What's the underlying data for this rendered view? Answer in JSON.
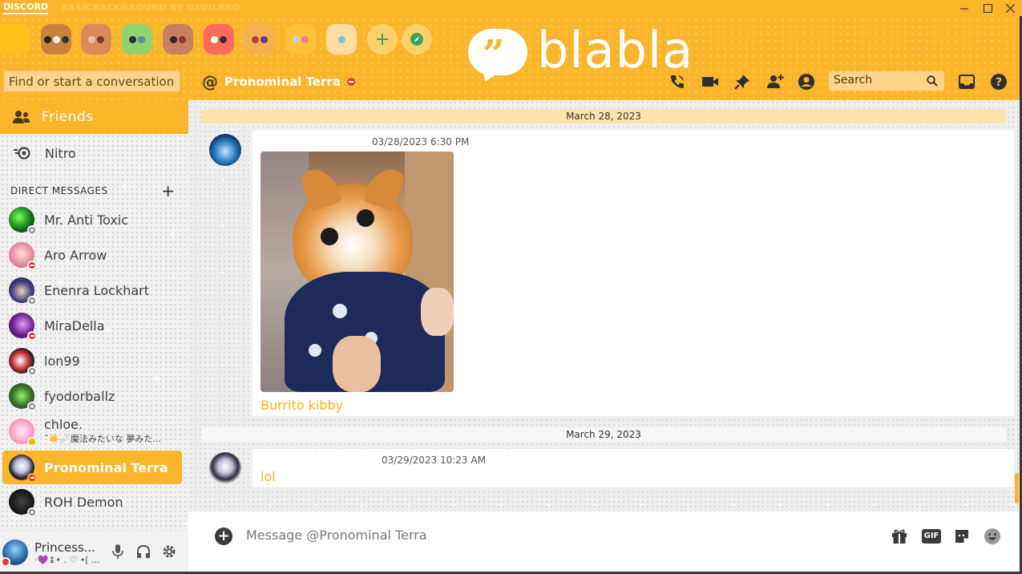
{
  "titlebar": {
    "wordmark": "DISCORD",
    "theme_text": "BASICBACKGROUND  BY  DEVILBRO"
  },
  "colors": {
    "accent": "#fbb52a",
    "dnd": "#e53935",
    "offline": "#8d8d8d",
    "link_text": "#f5b21a"
  },
  "logo": {
    "quote": "”",
    "text": "blabla"
  },
  "search_conversation": {
    "placeholder": "Find or start a conversation"
  },
  "channel": {
    "at": "@",
    "name": "Pronominal Terra"
  },
  "header_search": {
    "placeholder": "Search"
  },
  "nav": {
    "friends_label": "Friends",
    "nitro_label": "Nitro"
  },
  "dm_section": {
    "title": "DIRECT MESSAGES",
    "add": "+"
  },
  "dms": [
    {
      "name": "Mr. Anti Toxic",
      "status": "offline"
    },
    {
      "name": "Aro Arrow",
      "status": "dnd"
    },
    {
      "name": "Enenra Lockhart",
      "status": "offline"
    },
    {
      "name": "MiraDella",
      "status": "dnd"
    },
    {
      "name": "lon99",
      "status": "offline"
    },
    {
      "name": "fyodorballz",
      "status": "offline"
    },
    {
      "name": "chloe.",
      "sub": "˜☀️🩹魔法みたいな 夢みた...",
      "status": "idle"
    },
    {
      "name": "Pronominal Terra",
      "status": "dnd",
      "active": true
    },
    {
      "name": "ROH Demon",
      "status": "offline"
    }
  ],
  "user": {
    "name": "Princess...",
    "sub": "·💜↨• . ♡ •[ ..."
  },
  "messages": [
    {
      "date": "March 28, 2023",
      "time": "03/28/2023 6:30 PM",
      "text": "Burrito kibby"
    },
    {
      "date": "March 29, 2023",
      "time": "03/29/2023 10:23 AM",
      "text": "lol"
    }
  ],
  "composer": {
    "placeholder": "Message @Pronominal Terra",
    "gif_label": "GIF"
  }
}
